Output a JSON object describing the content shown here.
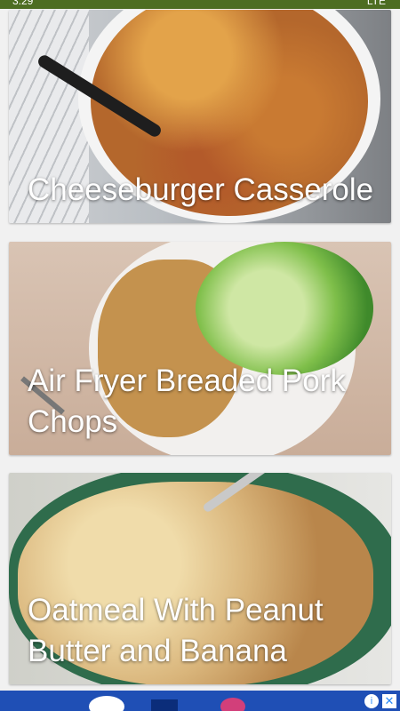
{
  "status_bar": {
    "time": "3:29",
    "right_text": "LTE"
  },
  "recipes": [
    {
      "title": "Cheeseburger Casserole"
    },
    {
      "title": "Air Fryer Breaded Pork Chops"
    },
    {
      "title": "Oatmeal With Peanut Butter and Banana"
    }
  ],
  "ad": {
    "info_glyph": "i",
    "close_glyph": "✕"
  }
}
